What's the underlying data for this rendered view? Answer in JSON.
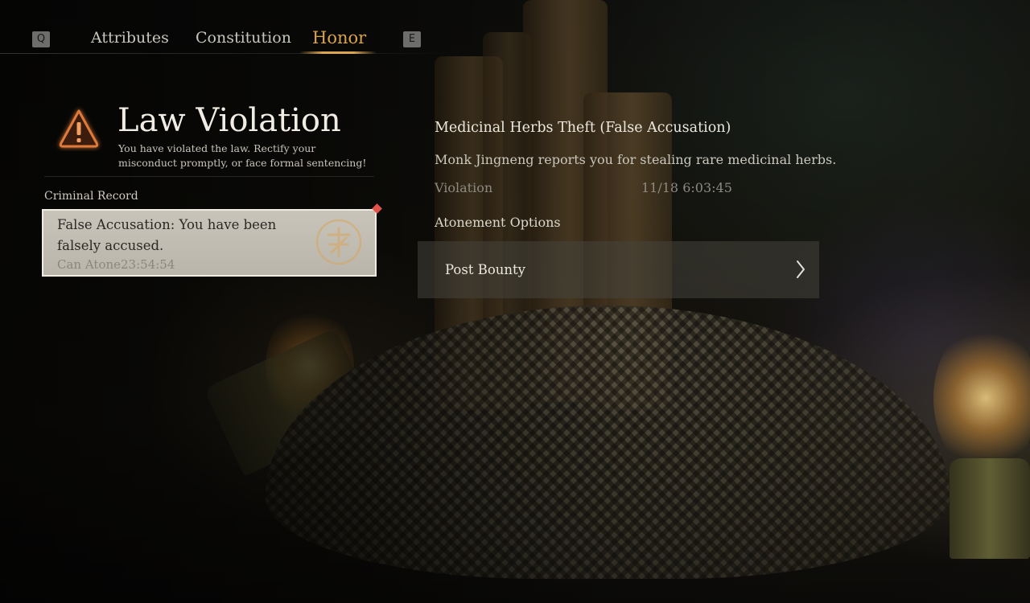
{
  "nav": {
    "left_key": "Q",
    "right_key": "E",
    "tabs": [
      {
        "label": "Attributes",
        "active": false
      },
      {
        "label": "Constitution",
        "active": false
      },
      {
        "label": "Honor",
        "active": true
      }
    ]
  },
  "law": {
    "title": "Law Violation",
    "description": "You have violated the law. Rectify your misconduct promptly, or face formal sentencing!"
  },
  "record": {
    "section_label": "Criminal Record",
    "entries": [
      {
        "text": "False Accusation: You have been falsely accused.",
        "timer": "Can Atone23:54:54",
        "selected": true
      }
    ]
  },
  "detail": {
    "title": "Medicinal Herbs Theft (False Accusation)",
    "description": "Monk Jingneng reports you for stealing rare medicinal herbs.",
    "violation_label": "Violation",
    "violation_time": "11/18 6:03:45",
    "atonement_label": "Atonement Options",
    "options": [
      {
        "label": "Post Bounty"
      }
    ]
  },
  "colors": {
    "active_tab": "#d9a54a",
    "warning_icon": "#e07a3a",
    "unread_marker": "#e0544b"
  },
  "icons": {
    "warning": "warning-triangle-icon",
    "seal": "seal-stamp-icon",
    "chevron": "chevron-right-icon"
  }
}
